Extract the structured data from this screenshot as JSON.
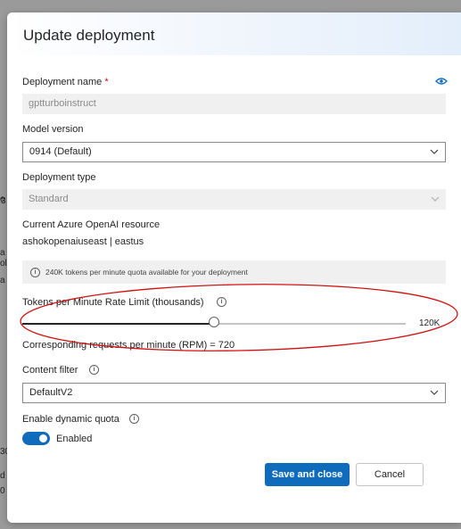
{
  "background_peek": [
    "e",
    "3",
    "a",
    "ol",
    "a",
    "30",
    "d",
    "0"
  ],
  "dialog": {
    "title": "Update deployment"
  },
  "deployment_name": {
    "label": "Deployment name",
    "required_marker": "*",
    "value": "gptturboinstruct"
  },
  "model_version": {
    "label": "Model version",
    "value": "0914 (Default)"
  },
  "deployment_type": {
    "label": "Deployment type",
    "value": "Standard"
  },
  "resource": {
    "label": "Current Azure OpenAI resource",
    "value": "ashokopenaiuseast | eastus"
  },
  "quota_info": {
    "text": "240K tokens per minute quota available for your deployment"
  },
  "rate_limit": {
    "label": "Tokens per Minute Rate Limit (thousands)",
    "min": 0,
    "max": 240,
    "value": 120,
    "value_label": "120K",
    "rpm_text": "Corresponding requests per minute (RPM) = 720"
  },
  "content_filter": {
    "label": "Content filter",
    "value": "DefaultV2"
  },
  "dynamic_quota": {
    "label": "Enable dynamic quota",
    "enabled": true,
    "state_label": "Enabled"
  },
  "buttons": {
    "save_label": "Save and close",
    "cancel_label": "Cancel"
  },
  "colors": {
    "accent": "#0f6cbd",
    "annotation_ellipse": "#d01010",
    "required": "#c50f1f"
  }
}
